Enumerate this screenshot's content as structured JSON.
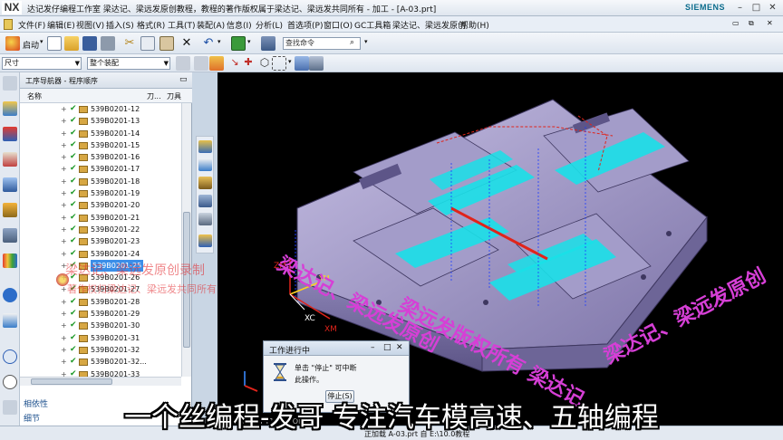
{
  "window": {
    "logo": "NX",
    "title": "达记发仔编程工作室  梁达记、梁远发原创教程，教程的著作版权属于梁达记、梁远发共同所有 - 加工 - [A-03.prt]",
    "brand": "SIEMENS"
  },
  "menu": [
    "文件(F)",
    "编辑(E)",
    "视图(V)",
    "插入(S)",
    "格式(R)",
    "工具(T)",
    "装配(A)",
    "信息(I)",
    "分析(L)",
    "首选项(P)",
    "窗口(O)",
    "GC工具箱",
    "梁达记、梁远发原创",
    "帮助(H)"
  ],
  "toolbar": {
    "auto_label": "启动",
    "search_placeholder": "查找命令",
    "dim_filter": "尺寸",
    "assembly_filter": "整个装配"
  },
  "navigator": {
    "title": "工序导航器 - 程序顺序",
    "columns": {
      "name": "名称",
      "tool_change": "刀...",
      "tool": "刀具"
    },
    "rows": [
      "539B0201-12",
      "539B0201-13",
      "539B0201-14",
      "539B0201-15",
      "539B0201-16",
      "539B0201-17",
      "539B0201-18",
      "539B0201-19",
      "539B0201-20",
      "539B0201-21",
      "539B0201-22",
      "539B0201-23",
      "539B0201-24",
      "539B0201-25",
      "539B0201-26",
      "539B0201-27",
      "539B0201-28",
      "539B0201-29",
      "539B0201-30",
      "539B0201-31",
      "539B0201-32",
      "539B0201-32...",
      "539B0201-33"
    ],
    "selected_index": 13,
    "subpanels": {
      "dependencies": "相依性",
      "details": "细节"
    }
  },
  "watermarks": {
    "panel_line1": "梁达记、梁远发原创录制",
    "panel_line2": "著作权归梁达记、梁远发共同所有",
    "viewport_line1": "梁达记、梁远发原创",
    "viewport_line2": "梁远发版权所有 梁达记、"
  },
  "viewport_labels": {
    "zm": "ZM",
    "ym": "YM",
    "xc": "XC",
    "xm": "XM",
    "lower_strip": "N  CM  UI T1  XC  I  OR  RC  I"
  },
  "dialog": {
    "title": "工作进行中",
    "message_line1": "单击 \"停止\" 可中断",
    "message_line2": "此操作。",
    "stop_button": "停止(S)"
  },
  "status": {
    "text": "正加载 A-03.prt 自 E:\\10.0教程"
  },
  "subtitle": "一个丝编程-发哥  专注汽车模高速、五轴编程",
  "colors": {
    "viewport_bg": "#000000",
    "part": "#9b93c2",
    "toolpath_fill": "#19e0e8",
    "selection": "#3b8ee8",
    "watermark": "#d63fd6"
  }
}
